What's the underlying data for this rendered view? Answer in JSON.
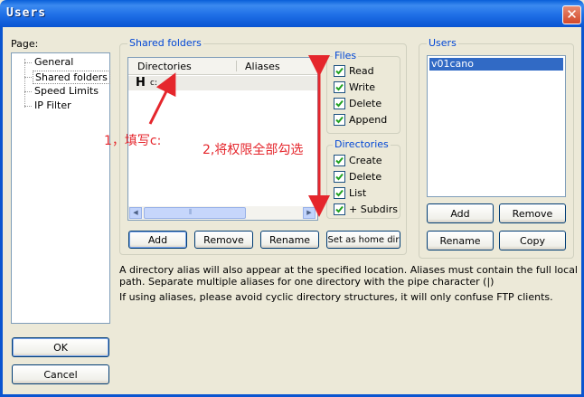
{
  "window": {
    "title": "Users",
    "close_glyph": "✕"
  },
  "page_label": "Page:",
  "tree": [
    {
      "label": "General"
    },
    {
      "label": "Shared folders"
    },
    {
      "label": "Speed Limits"
    },
    {
      "label": "IP Filter"
    }
  ],
  "shared_folders": {
    "title": "Shared folders",
    "columns": [
      "Directories",
      "Aliases"
    ],
    "rows": [
      {
        "home_marker": "H",
        "directory": "c:",
        "alias": ""
      }
    ],
    "scroll": {
      "left": "◀",
      "right": "▶",
      "grip": "⦀"
    },
    "buttons": {
      "add": "Add",
      "remove": "Remove",
      "rename": "Rename",
      "set_home": "Set as home dir"
    }
  },
  "files": {
    "title": "Files",
    "items": [
      {
        "label": "Read",
        "checked": true
      },
      {
        "label": "Write",
        "checked": true
      },
      {
        "label": "Delete",
        "checked": true
      },
      {
        "label": "Append",
        "checked": true
      }
    ]
  },
  "directories": {
    "title": "Directories",
    "items": [
      {
        "label": "Create",
        "checked": true
      },
      {
        "label": "Delete",
        "checked": true
      },
      {
        "label": "List",
        "checked": true
      },
      {
        "label": "+ Subdirs",
        "checked": true
      }
    ]
  },
  "users": {
    "title": "Users",
    "list": [
      "v01cano"
    ],
    "selected_index": 0,
    "buttons": {
      "add": "Add",
      "remove": "Remove",
      "rename": "Rename",
      "copy": "Copy"
    }
  },
  "info": {
    "line1": "A directory alias will also appear at the specified location. Aliases must contain the full local",
    "line2": "path. Separate multiple aliases for one directory with the pipe character (|)",
    "line3": "If using aliases, please avoid cyclic directory structures, it will only confuse FTP clients."
  },
  "dialog_buttons": {
    "ok": "OK",
    "cancel": "Cancel"
  },
  "annotations": {
    "step1": "1，填写c:",
    "step2": "2,将权限全部勾选"
  },
  "colors": {
    "title_bar": "#0a5fd8",
    "group_title": "#0046d5",
    "selection": "#316ac5",
    "annotation": "#e5262c"
  }
}
